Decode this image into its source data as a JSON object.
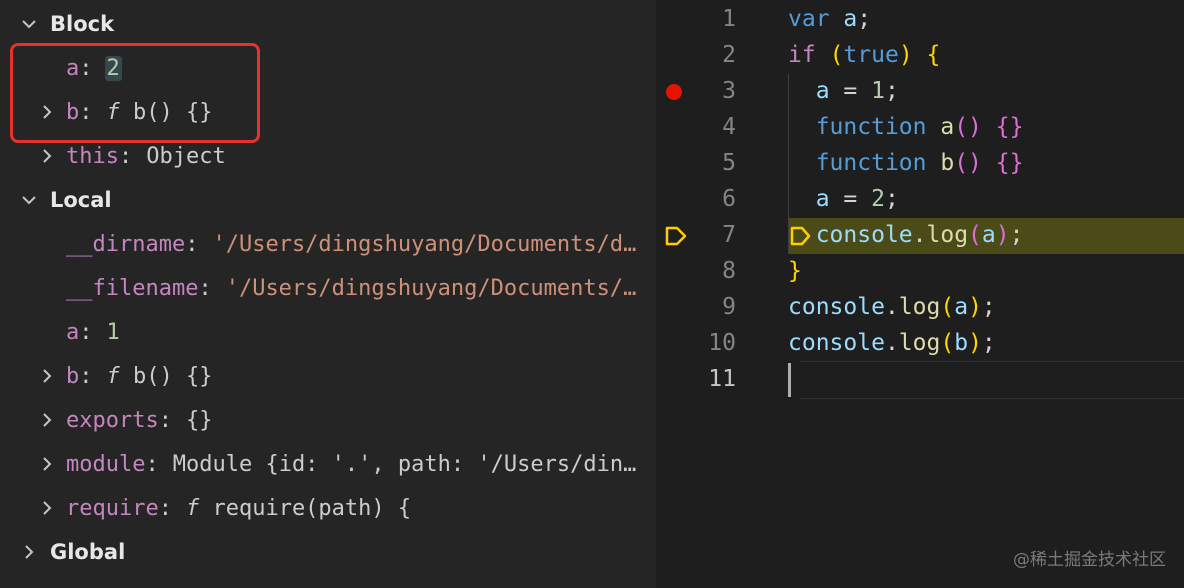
{
  "variables": {
    "block": {
      "title": "Block",
      "items": [
        {
          "key": "a",
          "value": "2"
        },
        {
          "key": "b",
          "fsym": "f",
          "value": "b() {}"
        },
        {
          "key": "this",
          "value": "Object"
        }
      ]
    },
    "local": {
      "title": "Local",
      "items": [
        {
          "key": "__dirname",
          "value": "'/Users/dingshuyang/Documents/de…"
        },
        {
          "key": "__filename",
          "value": "'/Users/dingshuyang/Documents/d…"
        },
        {
          "key": "a",
          "value": "1"
        },
        {
          "key": "b",
          "fsym": "f",
          "value": "b() {}"
        },
        {
          "key": "exports",
          "value": "{}"
        },
        {
          "key": "module",
          "value": "Module {id: '.', path: '/Users/ding…"
        },
        {
          "key": "require",
          "fsym": "f",
          "value": "require(path) {"
        }
      ]
    },
    "global": {
      "title": "Global"
    }
  },
  "editor": {
    "line_numbers": [
      "1",
      "2",
      "3",
      "4",
      "5",
      "6",
      "7",
      "8",
      "9",
      "10",
      "11"
    ],
    "lines": [
      [
        {
          "t": "var",
          "c": "kw"
        },
        {
          "t": " "
        },
        {
          "t": "a",
          "c": "id"
        },
        {
          "t": ";"
        }
      ],
      [
        {
          "t": "if",
          "c": "ctl"
        },
        {
          "t": " "
        },
        {
          "t": "(",
          "c": "p1"
        },
        {
          "t": "true",
          "c": "kw"
        },
        {
          "t": ")",
          "c": "p1"
        },
        {
          "t": " "
        },
        {
          "t": "{",
          "c": "p1"
        }
      ],
      [
        {
          "t": "  "
        },
        {
          "t": "a",
          "c": "id"
        },
        {
          "t": " = "
        },
        {
          "t": "1",
          "c": "num"
        },
        {
          "t": ";"
        }
      ],
      [
        {
          "t": "  "
        },
        {
          "t": "function",
          "c": "kw"
        },
        {
          "t": " "
        },
        {
          "t": "a",
          "c": "fn"
        },
        {
          "t": "()",
          "c": "p2"
        },
        {
          "t": " "
        },
        {
          "t": "{}",
          "c": "p2"
        }
      ],
      [
        {
          "t": "  "
        },
        {
          "t": "function",
          "c": "kw"
        },
        {
          "t": " "
        },
        {
          "t": "b",
          "c": "fn"
        },
        {
          "t": "()",
          "c": "p2"
        },
        {
          "t": " "
        },
        {
          "t": "{}",
          "c": "p2"
        }
      ],
      [
        {
          "t": "  "
        },
        {
          "t": "a",
          "c": "id"
        },
        {
          "t": " = "
        },
        {
          "t": "2",
          "c": "num"
        },
        {
          "t": ";"
        }
      ],
      [
        {
          "t": "  "
        },
        {
          "t": "console",
          "c": "id"
        },
        {
          "t": "."
        },
        {
          "t": "log",
          "c": "fn"
        },
        {
          "t": "(",
          "c": "p2"
        },
        {
          "t": "a",
          "c": "id"
        },
        {
          "t": ")",
          "c": "p2"
        },
        {
          "t": ";"
        }
      ],
      [
        {
          "t": "}",
          "c": "p1"
        }
      ],
      [
        {
          "t": "console",
          "c": "id"
        },
        {
          "t": "."
        },
        {
          "t": "log",
          "c": "fn"
        },
        {
          "t": "(",
          "c": "p1"
        },
        {
          "t": "a",
          "c": "id"
        },
        {
          "t": ")",
          "c": "p1"
        },
        {
          "t": ";"
        }
      ],
      [
        {
          "t": "console",
          "c": "id"
        },
        {
          "t": "."
        },
        {
          "t": "log",
          "c": "fn"
        },
        {
          "t": "(",
          "c": "p1"
        },
        {
          "t": "b",
          "c": "id"
        },
        {
          "t": ")",
          "c": "p1"
        },
        {
          "t": ";"
        }
      ],
      []
    ],
    "breakpoint_line": 3,
    "paused_line": 7,
    "active_line": 11
  },
  "colors": {
    "accent_red": "#e5322d",
    "breakpoint": "#e51400",
    "paused_arrow": "#ffcc00"
  },
  "watermark": "@稀土掘金技术社区"
}
